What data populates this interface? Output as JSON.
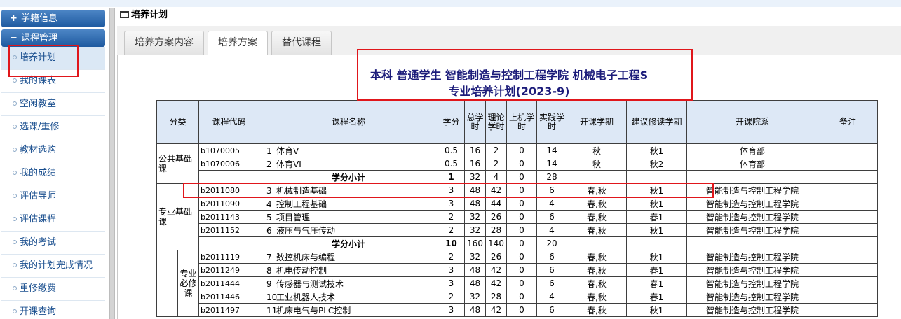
{
  "sidebar": {
    "groups": [
      {
        "sign": "+",
        "label": "学籍信息"
      },
      {
        "sign": "−",
        "label": "课程管理"
      }
    ],
    "items": [
      {
        "label": "培养计划"
      },
      {
        "label": "我的课表"
      },
      {
        "label": "空闲教室"
      },
      {
        "label": "选课/重修"
      },
      {
        "label": "教材选购"
      },
      {
        "label": "我的成绩"
      },
      {
        "label": "评估导师"
      },
      {
        "label": "评估课程"
      },
      {
        "label": "我的考试"
      },
      {
        "label": "我的计划完成情况"
      },
      {
        "label": "重修缴费"
      },
      {
        "label": "开课查询"
      }
    ]
  },
  "main": {
    "title": "培养计划",
    "tabs": [
      {
        "label": "培养方案内容"
      },
      {
        "label": "培养方案"
      },
      {
        "label": "替代课程"
      }
    ],
    "plan_title_line1": "本科 普通学生 智能制造与控制工程学院 机械电子工程S",
    "plan_title_line2": "专业培养计划(2023-9)"
  },
  "table": {
    "headers": [
      "分类",
      "课程代码",
      "课程名称",
      "学分",
      "总学时",
      "理论学时",
      "上机学时",
      "实践学时",
      "开课学期",
      "建议修读学期",
      "开课院系",
      "备注"
    ],
    "categories": {
      "public": "公共基础课",
      "major_basic": "专业基础课",
      "major_required": "专业必修课"
    },
    "subtotal_label": "学分小计",
    "rows_public": [
      {
        "code": "b1070005",
        "no": "1",
        "name": "体育V",
        "credit": "0.5",
        "total": "16",
        "theory": "2",
        "computer": "0",
        "practice": "14",
        "term": "秋",
        "suggest": "秋1",
        "dept": "体育部",
        "note": ""
      },
      {
        "code": "b1070006",
        "no": "2",
        "name": "体育VI",
        "credit": "0.5",
        "total": "16",
        "theory": "2",
        "computer": "0",
        "practice": "14",
        "term": "秋",
        "suggest": "秋2",
        "dept": "体育部",
        "note": ""
      }
    ],
    "subtotal_public": {
      "credit": "1",
      "total": "32",
      "theory": "4",
      "computer": "0",
      "practice": "28"
    },
    "rows_major_basic": [
      {
        "code": "b2011080",
        "no": "3",
        "name": "机械制造基础",
        "credit": "3",
        "total": "48",
        "theory": "42",
        "computer": "0",
        "practice": "6",
        "term": "春,秋",
        "suggest": "秋1",
        "dept": "智能制造与控制工程学院",
        "note": ""
      },
      {
        "code": "b2011090",
        "no": "4",
        "name": "控制工程基础",
        "credit": "3",
        "total": "48",
        "theory": "44",
        "computer": "0",
        "practice": "4",
        "term": "春,秋",
        "suggest": "秋1",
        "dept": "智能制造与控制工程学院",
        "note": ""
      },
      {
        "code": "b2011143",
        "no": "5",
        "name": "项目管理",
        "credit": "2",
        "total": "32",
        "theory": "26",
        "computer": "0",
        "practice": "6",
        "term": "春,秋",
        "suggest": "春1",
        "dept": "智能制造与控制工程学院",
        "note": ""
      },
      {
        "code": "b2011152",
        "no": "6",
        "name": "液压与气压传动",
        "credit": "2",
        "total": "32",
        "theory": "28",
        "computer": "0",
        "practice": "4",
        "term": "春,秋",
        "suggest": "秋1",
        "dept": "智能制造与控制工程学院",
        "note": ""
      }
    ],
    "subtotal_major_basic": {
      "credit": "10",
      "total": "160",
      "theory": "140",
      "computer": "0",
      "practice": "20"
    },
    "rows_major_required": [
      {
        "code": "b2011119",
        "no": "7",
        "name": "数控机床与编程",
        "credit": "2",
        "total": "32",
        "theory": "26",
        "computer": "0",
        "practice": "6",
        "term": "春,秋",
        "suggest": "秋1",
        "dept": "智能制造与控制工程学院",
        "note": ""
      },
      {
        "code": "b2011249",
        "no": "8",
        "name": "机电传动控制",
        "credit": "3",
        "total": "48",
        "theory": "42",
        "computer": "0",
        "practice": "6",
        "term": "春,秋",
        "suggest": "春1",
        "dept": "智能制造与控制工程学院",
        "note": ""
      },
      {
        "code": "b2011444",
        "no": "9",
        "name": "传感器与测试技术",
        "credit": "3",
        "total": "48",
        "theory": "42",
        "computer": "0",
        "practice": "6",
        "term": "春,秋",
        "suggest": "春1",
        "dept": "智能制造与控制工程学院",
        "note": ""
      },
      {
        "code": "b2011446",
        "no": "10",
        "name": "工业机器人技术",
        "credit": "2",
        "total": "32",
        "theory": "28",
        "computer": "0",
        "practice": "4",
        "term": "春,秋",
        "suggest": "春1",
        "dept": "智能制造与控制工程学院",
        "note": ""
      },
      {
        "code": "b2011497",
        "no": "11",
        "name": "机床电气与PLC控制",
        "credit": "3",
        "total": "48",
        "theory": "42",
        "computer": "0",
        "practice": "6",
        "term": "春,秋",
        "suggest": "秋1",
        "dept": "智能制造与控制工程学院",
        "note": ""
      }
    ]
  }
}
